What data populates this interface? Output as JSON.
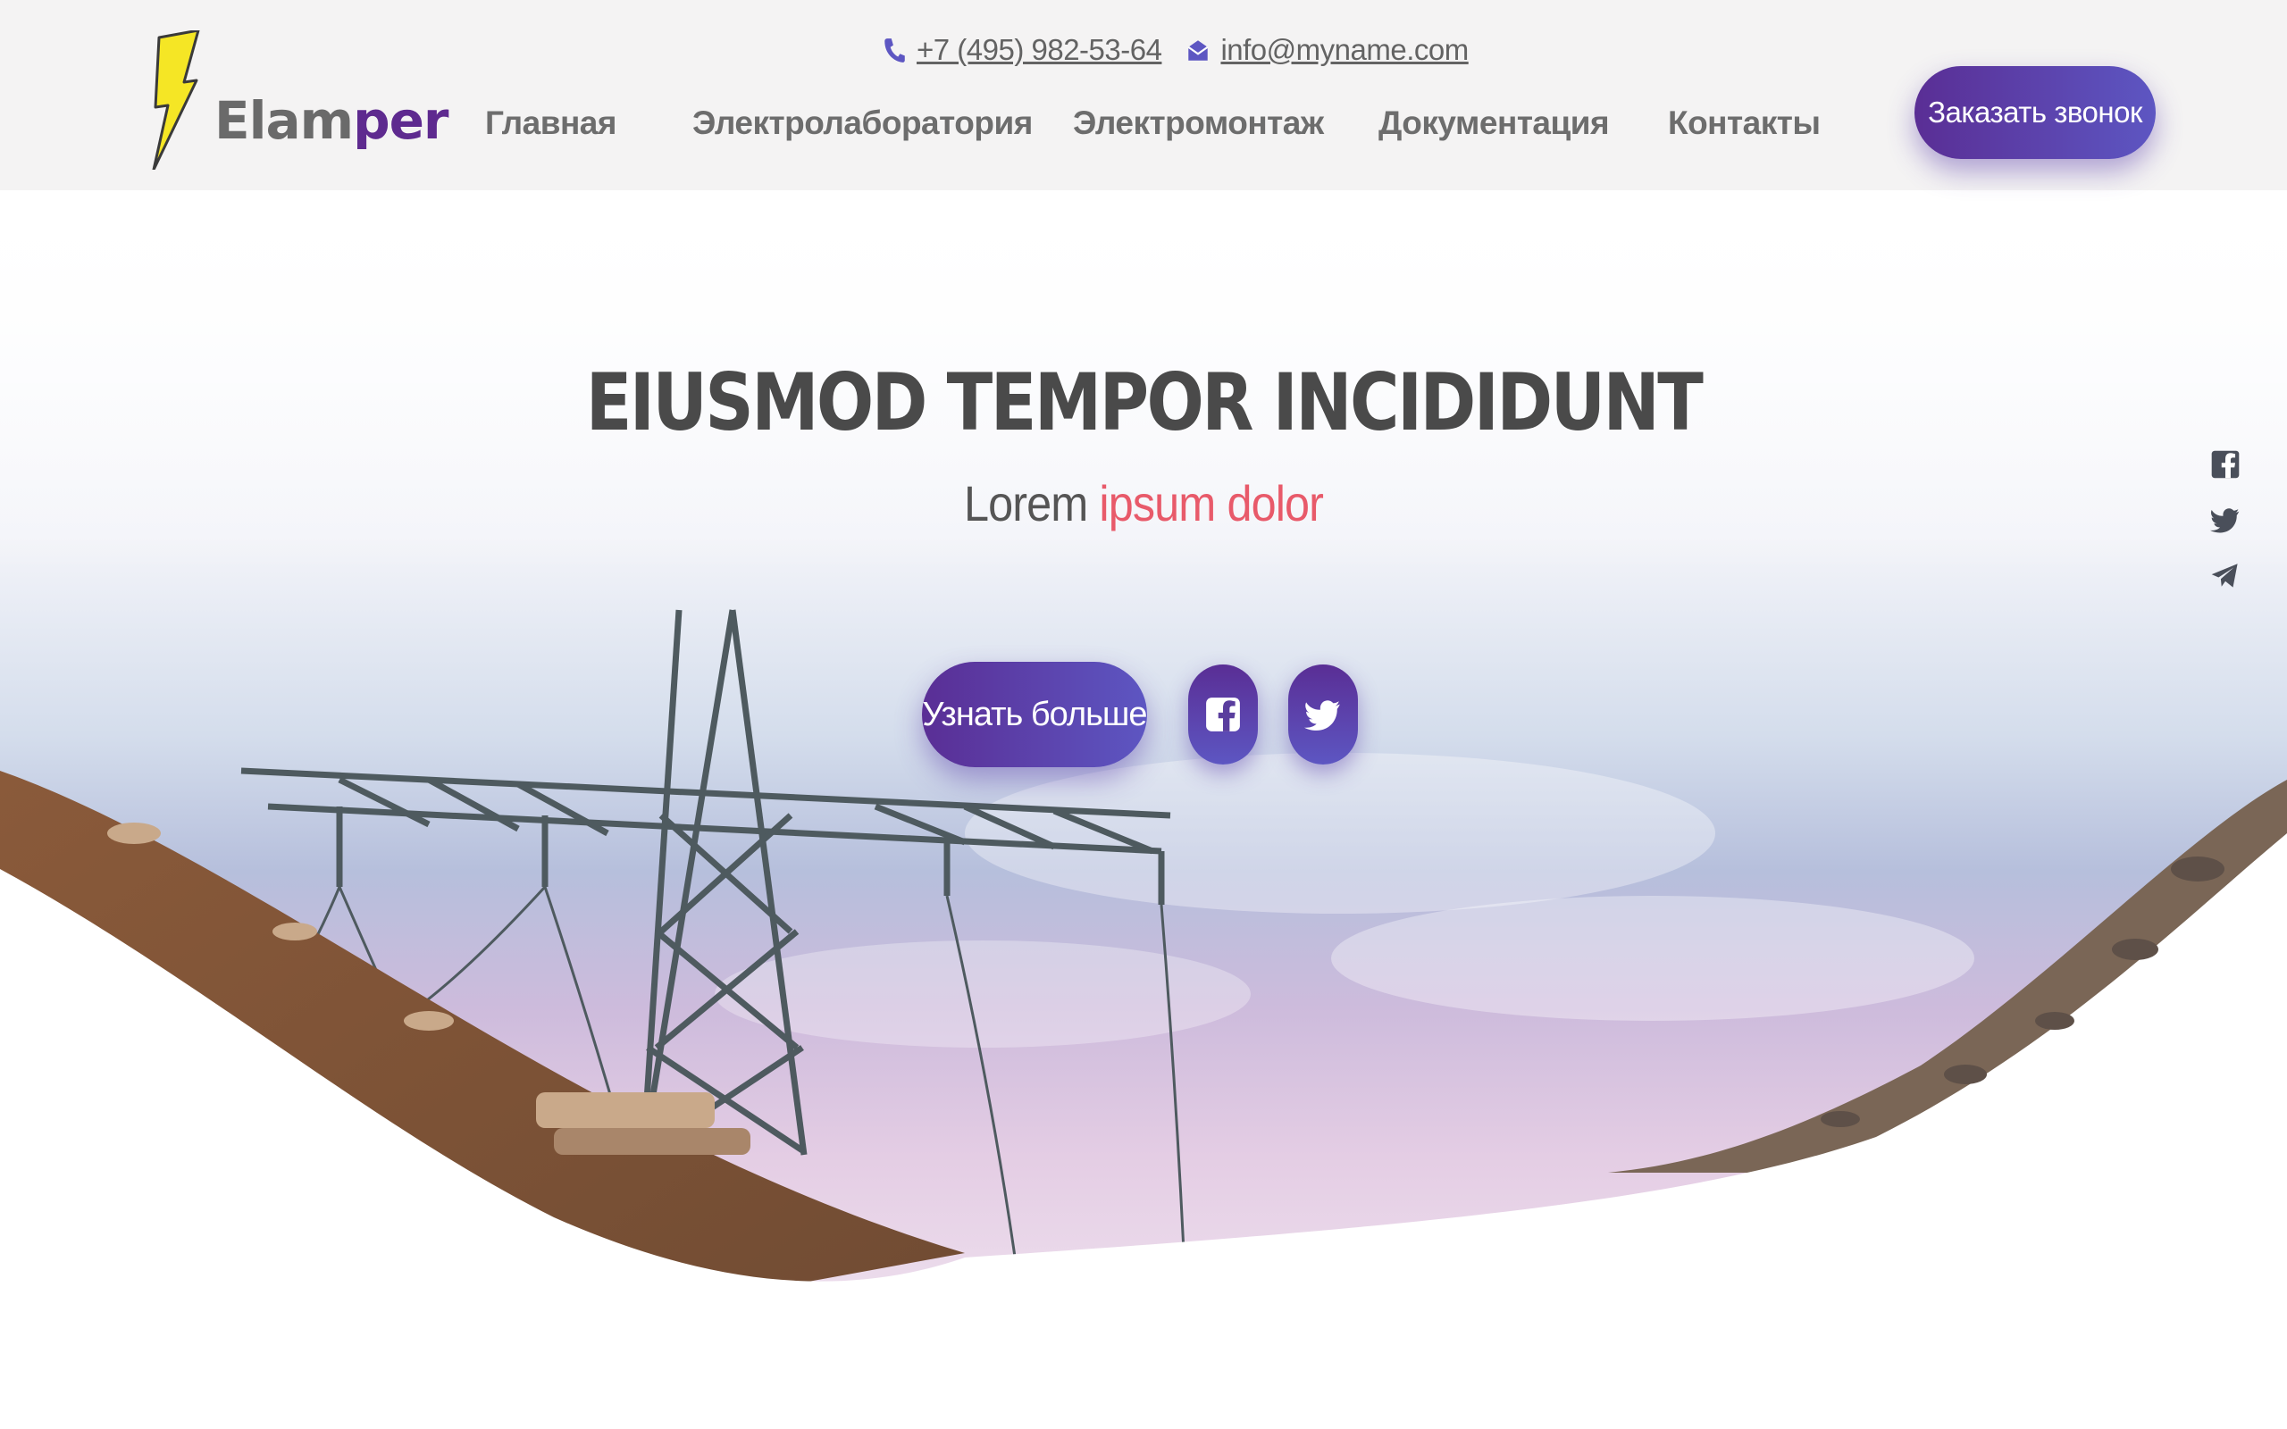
{
  "brand": {
    "logo_part1": "Elam",
    "logo_part2": "per",
    "bolt_color": "#f5e625",
    "accent_purple": "#5e2a8f"
  },
  "header": {
    "phone": "+7 (495) 982-53-64",
    "email": "info@myname.com",
    "nav": [
      "Главная",
      "Электролаборатория",
      "Электромонтаж",
      "Документация",
      "Контакты"
    ],
    "cta_label": "Заказать звонок"
  },
  "hero": {
    "title": "EIUSMOD TEMPOR INCIDIDUNT",
    "subtitle_plain": "Lorem",
    "subtitle_accent": "ipsum dolor",
    "subtitle_accent_color": "#e85a6a",
    "learn_more_label": "Узнать больше",
    "round_buttons": [
      "facebook-icon",
      "twitter-icon"
    ]
  },
  "side_social": [
    "facebook-icon",
    "twitter-icon",
    "telegram-icon"
  ],
  "colors": {
    "button_gradient_start": "#5a2e95",
    "button_gradient_end": "#5d56c2",
    "header_bg": "#f4f3f3"
  }
}
